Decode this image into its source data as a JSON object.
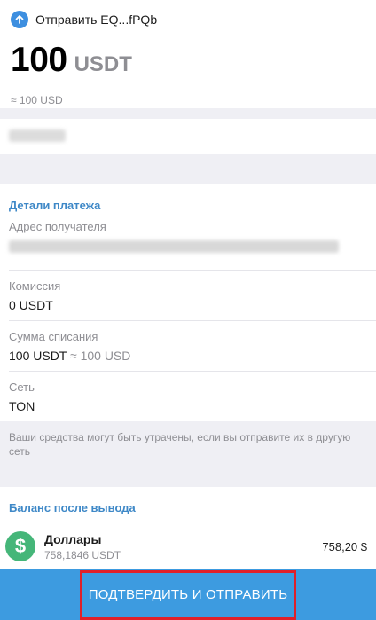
{
  "header": {
    "title": "Отправить EQ...fPQb",
    "amount_value": "100",
    "amount_currency": "USDT",
    "amount_usd": "≈ 100 USD"
  },
  "details": {
    "section_title": "Детали платежа",
    "recipient_label": "Адрес получателя",
    "fee_label": "Комиссия",
    "fee_value": "0 USDT",
    "debit_label": "Сумма списания",
    "debit_value": "100 USDT",
    "debit_usd": "≈ 100 USD",
    "network_label": "Сеть",
    "network_value": "TON"
  },
  "warning": {
    "text": "Ваши средства могут быть утрачены, если вы отправите их в другую сеть"
  },
  "balance": {
    "section_title": "Баланс после вывода",
    "asset_name": "Доллары",
    "asset_amount": "758,1846 USDT",
    "fiat_amount": "758,20 $",
    "icon_symbol": "$"
  },
  "footer": {
    "confirm_label": "ПОДТВЕРДИТЬ И ОТПРАВИТЬ"
  },
  "colors": {
    "accent": "#3d9be0",
    "section_header": "#3e88c7",
    "highlight_border": "#e0202a",
    "dollar_icon": "#45b679"
  }
}
